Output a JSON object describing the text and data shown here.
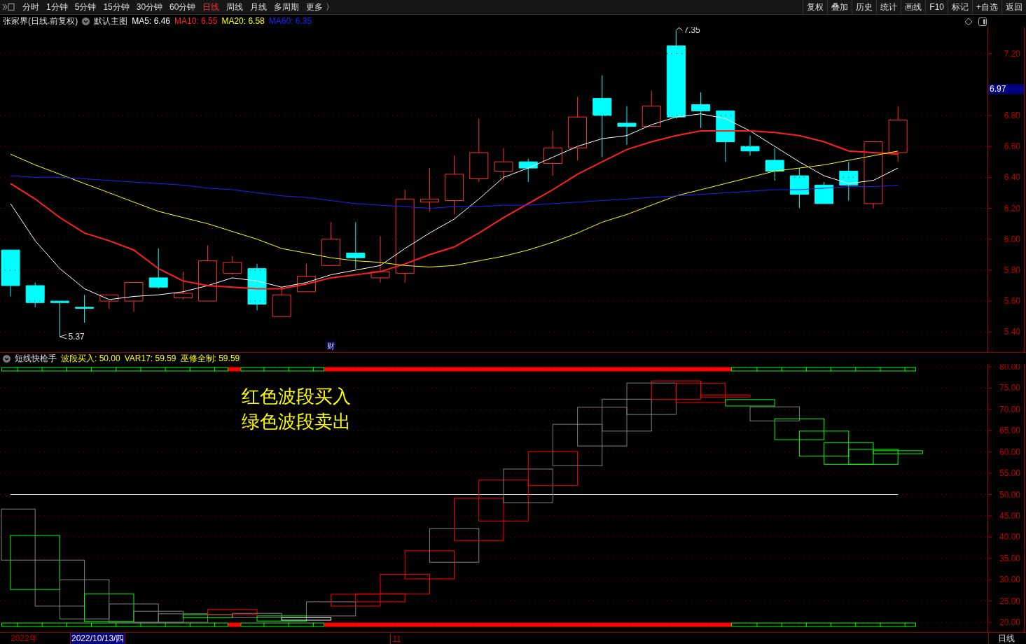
{
  "toolbar": {
    "tabs": [
      {
        "label": "分时",
        "selected": false
      },
      {
        "label": "1分钟",
        "selected": false
      },
      {
        "label": "5分钟",
        "selected": false
      },
      {
        "label": "15分钟",
        "selected": false
      },
      {
        "label": "30分钟",
        "selected": false
      },
      {
        "label": "60分钟",
        "selected": false
      },
      {
        "label": "日线",
        "selected": true
      },
      {
        "label": "周线",
        "selected": false
      },
      {
        "label": "月线",
        "selected": false
      },
      {
        "label": "多周期",
        "selected": false
      },
      {
        "label": "更多 〉",
        "selected": false
      }
    ],
    "buttons": [
      "复权",
      "叠加",
      "历史",
      "统计",
      "画线",
      "F10",
      "标记",
      "+自选",
      "返回"
    ]
  },
  "price_chart": {
    "title": "张家界(日线.前复权)",
    "template": "默认主图",
    "legend": [
      {
        "label": "MA5: 6.46",
        "color": "#ffffff"
      },
      {
        "label": "MA10: 6.55",
        "color": "#ff2020"
      },
      {
        "label": "MA20: 6.58",
        "color": "#ffff00"
      },
      {
        "label": "MA60: 6.35",
        "color": "#2020ff"
      }
    ],
    "current_price": "6.97",
    "event_marker": "财",
    "chart_data": {
      "type": "line",
      "ylim": [
        5.27,
        7.37
      ],
      "grid": true,
      "yticks": [
        {
          "value": 5.4,
          "label": "5.40"
        },
        {
          "value": 5.6,
          "label": "5.60"
        },
        {
          "value": 5.8,
          "label": "5.80"
        },
        {
          "value": 6.0,
          "label": "6.00"
        },
        {
          "value": 6.2,
          "label": "6.20"
        },
        {
          "value": 6.4,
          "label": "6.40"
        },
        {
          "value": 6.6,
          "label": "6.60"
        },
        {
          "value": 6.8,
          "label": "6.80"
        },
        {
          "value": 7.2,
          "label": "7.20"
        }
      ],
      "series": [
        {
          "color": "#ffffff",
          "values": [
            6.23,
            5.99,
            5.81,
            5.68,
            5.61,
            5.63,
            5.64,
            5.66,
            5.7,
            5.75,
            5.73,
            5.69,
            5.72,
            5.77,
            5.8,
            5.83,
            5.94,
            6.04,
            6.13,
            6.26,
            6.4,
            6.46,
            6.53,
            6.6,
            6.65,
            6.67,
            6.74,
            6.79,
            6.81,
            6.78,
            6.7,
            6.6,
            6.5,
            6.41,
            6.36,
            6.38,
            6.46
          ]
        },
        {
          "color": "#ff2020",
          "values": [
            6.36,
            6.26,
            6.14,
            6.04,
            5.99,
            5.93,
            5.81,
            5.73,
            5.7,
            5.69,
            5.68,
            5.68,
            5.71,
            5.75,
            5.77,
            5.79,
            5.84,
            5.9,
            5.95,
            6.04,
            6.14,
            6.23,
            6.32,
            6.42,
            6.5,
            6.58,
            6.63,
            6.67,
            6.7,
            6.7,
            6.7,
            6.69,
            6.67,
            6.63,
            6.57,
            6.56,
            6.55
          ]
        },
        {
          "color": "#ffff00",
          "values": [
            6.55,
            6.48,
            6.42,
            6.36,
            6.3,
            6.24,
            6.18,
            6.14,
            6.1,
            6.05,
            6.0,
            5.94,
            5.91,
            5.88,
            5.86,
            5.85,
            5.83,
            5.82,
            5.83,
            5.86,
            5.89,
            5.93,
            5.98,
            6.04,
            6.11,
            6.16,
            6.22,
            6.28,
            6.32,
            6.36,
            6.4,
            6.44,
            6.46,
            6.48,
            6.51,
            6.54,
            6.57
          ]
        },
        {
          "color": "#2020ff",
          "values": [
            6.41,
            6.4,
            6.4,
            6.39,
            6.38,
            6.37,
            6.36,
            6.35,
            6.33,
            6.32,
            6.3,
            6.28,
            6.27,
            6.25,
            6.23,
            6.22,
            6.21,
            6.2,
            6.21,
            6.21,
            6.22,
            6.22,
            6.23,
            6.24,
            6.25,
            6.26,
            6.27,
            6.28,
            6.29,
            6.3,
            6.31,
            6.32,
            6.32,
            6.33,
            6.34,
            6.34,
            6.35
          ]
        }
      ],
      "annotations": [
        "7.35",
        "5.37"
      ]
    }
  },
  "indicator": {
    "name": "短线快枪手",
    "values": [
      "波段买入: 50.00",
      "VAR17: 59.59",
      "巫修全制: 59.59"
    ],
    "notes": [
      "红色波段买入",
      "绿色波段卖出"
    ],
    "axis_labels": [
      "80.00",
      "75.00",
      "70.00",
      "65.00",
      "60.00",
      "55.00",
      "50.00",
      "45.00",
      "40.00",
      "35.00",
      "30.00",
      "25.00",
      "20.00"
    ]
  },
  "time_axis": {
    "year": "2022年",
    "cursor_date": "2022/10/13/四",
    "month": "11",
    "period": "日线"
  }
}
